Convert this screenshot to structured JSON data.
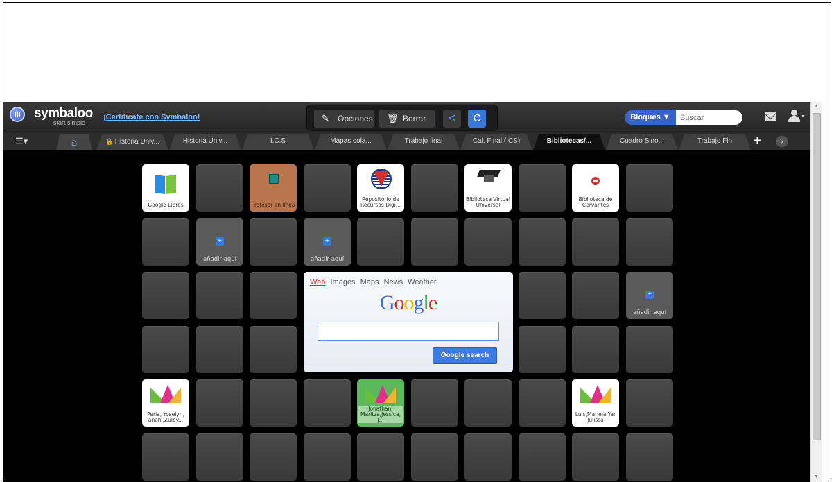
{
  "app": {
    "logo_text": "symbaloo",
    "logo_subtext": "start simple",
    "certificate_link": "¡Certificate con Symbaloo!",
    "accent_color": "#3a78d8"
  },
  "toolbar": {
    "options_label": "Opciones",
    "delete_label": "Borrar",
    "bloques_label": "Bloques ▼",
    "search_placeholder": "Buscar"
  },
  "tabs": [
    {
      "label": "Historia Univ...",
      "locked": true
    },
    {
      "label": "Historia Univ...",
      "locked": false
    },
    {
      "label": "I.C.S",
      "locked": false
    },
    {
      "label": "Mapas cola...",
      "locked": false
    },
    {
      "label": "Trabajo final",
      "locked": false
    },
    {
      "label": "Cal. Final (ICS)",
      "locked": false
    },
    {
      "label": "Bibliotecas/...",
      "locked": false,
      "active": true
    },
    {
      "label": "Cuadro Sino...",
      "locked": false
    },
    {
      "label": "Trabajo Fin",
      "locked": false
    }
  ],
  "tiles": {
    "google_libros": "Google Libros",
    "profesor_en_linea": "Profesor en línea",
    "repositorio": "Repositorio de Recursos Digi...",
    "biblioteca_virtual": "Biblioteca Virtual Universal",
    "biblioteca_cervantes": "Biblioteca de Cervantes",
    "add_here": "añadir aquí",
    "perla": "Perla, Yoselyn, anahi,Zuley...",
    "jonathan": "Jonathan, Maritza,Jessica, J...",
    "luis": "Luis,Mariela,Yar Julissa"
  },
  "google_widget": {
    "tabs": [
      "Web",
      "Images",
      "Maps",
      "News",
      "Weather"
    ],
    "active_tab": "Web",
    "logo_letters": [
      "G",
      "o",
      "o",
      "g",
      "l",
      "e"
    ],
    "logo_colors": [
      "#3b6fd6",
      "#d62d20",
      "#f0b400",
      "#3b6fd6",
      "#2e9f3f",
      "#d62d20"
    ],
    "search_value": "",
    "button_label": "Google search"
  }
}
